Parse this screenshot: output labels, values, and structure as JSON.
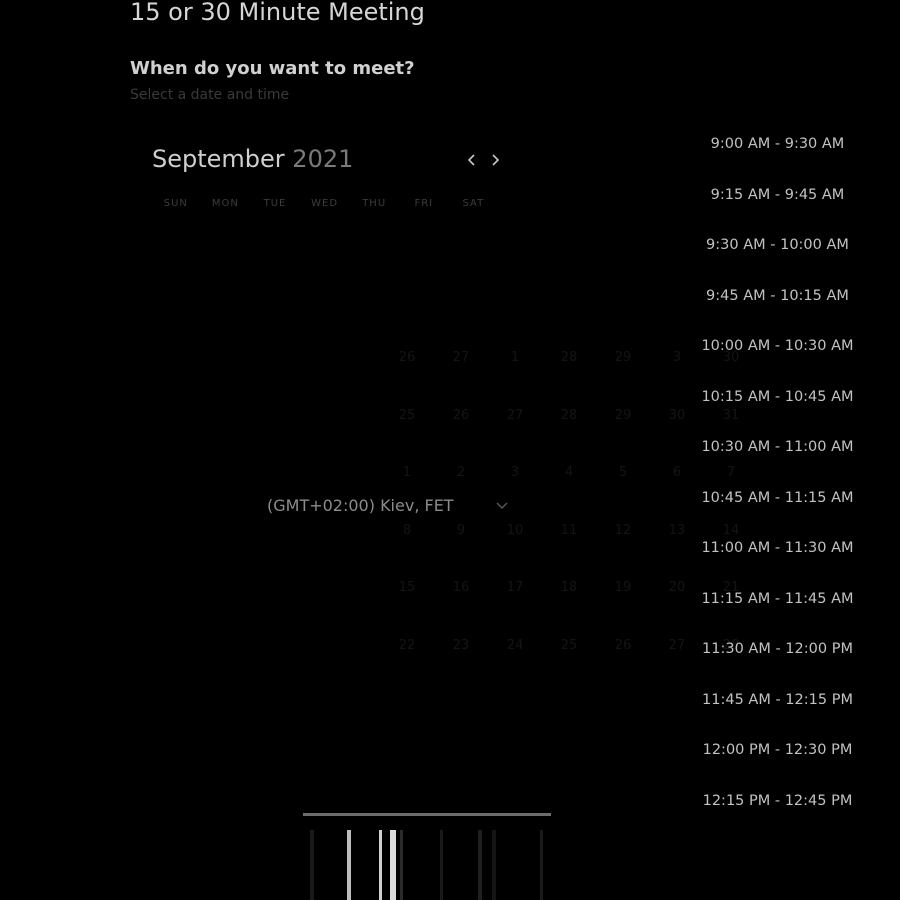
{
  "header": {
    "title": "15 or 30 Minute Meeting",
    "question": "When do you want to meet?",
    "helper": "Select a date and time"
  },
  "calendar": {
    "month": "September",
    "year": "2021",
    "prev_icon": "chevron-left-icon",
    "next_icon": "chevron-right-icon",
    "weekdays": [
      "SUN",
      "MON",
      "TUE",
      "WED",
      "THU",
      "FRI",
      "SAT"
    ],
    "dates": [
      "26",
      "27",
      "1",
      "28",
      "29",
      "3",
      "30",
      "25",
      "26",
      "27",
      "28",
      "29",
      "30",
      "31",
      "1",
      "2",
      "3",
      "4",
      "5",
      "6",
      "7",
      "8",
      "9",
      "10",
      "11",
      "12",
      "13",
      "14",
      "15",
      "16",
      "17",
      "18",
      "19",
      "20",
      "21",
      "22",
      "23",
      "24",
      "25",
      "26",
      "27",
      "28"
    ]
  },
  "timezone": {
    "label": "(GMT+02:00) Kiev, FET",
    "icon": "chevron-down-icon"
  },
  "time_slots": [
    "9:00 AM - 9:30 AM",
    "9:15 AM - 9:45 AM",
    "9:30 AM - 10:00 AM",
    "9:45 AM - 10:15 AM",
    "10:00 AM - 10:30 AM",
    "10:15 AM - 10:45 AM",
    "10:30 AM - 11:00 AM",
    "10:45 AM - 11:15 AM",
    "11:00 AM - 11:30 AM",
    "11:15 AM - 11:45 AM",
    "11:30 AM - 12:00 PM",
    "11:45 AM - 12:15 PM",
    "12:00 PM - 12:30 PM",
    "12:15 PM - 12:45 PM"
  ],
  "colors": {
    "background": "#000000",
    "text_primary": "#d6d6d6",
    "text_muted": "#3a3a3a",
    "divider": "#6c6c6c"
  }
}
